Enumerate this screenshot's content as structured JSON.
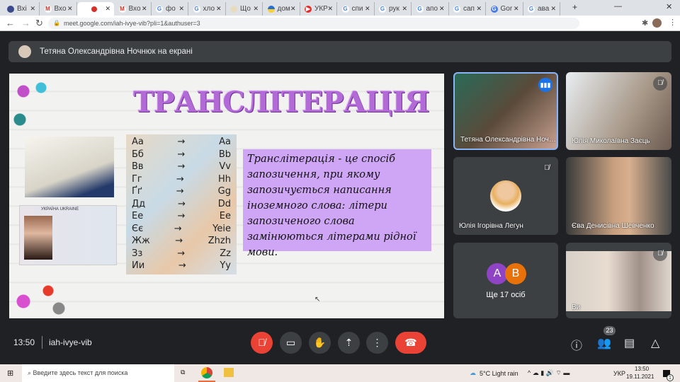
{
  "browser": {
    "tabs": [
      {
        "label": "Вхі",
        "icon": "app"
      },
      {
        "label": "Вхо",
        "icon": "gmail"
      },
      {
        "label": "",
        "icon": "meet",
        "active": true
      },
      {
        "label": "Вхо",
        "icon": "gmail"
      },
      {
        "label": "фо",
        "icon": "google"
      },
      {
        "label": "хло",
        "icon": "google"
      },
      {
        "label": "Що",
        "icon": "book"
      },
      {
        "label": "дом",
        "icon": "flag"
      },
      {
        "label": "УКР",
        "icon": "youtube"
      },
      {
        "label": "спи",
        "icon": "google"
      },
      {
        "label": "рук",
        "icon": "google"
      },
      {
        "label": "апо",
        "icon": "google"
      },
      {
        "label": "сап",
        "icon": "google"
      },
      {
        "label": "Gor",
        "icon": "translate"
      },
      {
        "label": "ава",
        "icon": "google"
      }
    ],
    "url": "meet.google.com/iah-ivye-vib?pli=1&authuser=3"
  },
  "presenter": {
    "label": "Тетяна Олександрівна Ночнюк на екрані"
  },
  "slide": {
    "title": "ТРАНСЛІТЕРАЦІЯ",
    "translit_table": [
      [
        "Аа",
        "Aa"
      ],
      [
        "Бб",
        "Bb"
      ],
      [
        "Вв",
        "Vv"
      ],
      [
        "Гг",
        "Hh"
      ],
      [
        "Ґґ",
        "Gg"
      ],
      [
        "Дд",
        "Dd"
      ],
      [
        "Ее",
        "Ee"
      ],
      [
        "Єє",
        "Yeie"
      ],
      [
        "Жж",
        "Zhzh"
      ],
      [
        "Зз",
        "Zz"
      ],
      [
        "Ии",
        "Yy"
      ]
    ],
    "arrow": "→",
    "definition": "Транслітерація - це спосіб запозичення, при якому запозичується написання іноземного слова: літери запозиченого слова замінюються літерами рідної мови.",
    "passport_label": "УКРАЇНА UKRAINE"
  },
  "participants": [
    {
      "name": "Тетяна Олександрівна Ночнюк",
      "speaking": true
    },
    {
      "name": "Юлія Миколаївна Заєць",
      "muted": true
    },
    {
      "name": "Юлія Ігорівна Легун",
      "muted": true
    },
    {
      "name": "Єва Денисівна Шевченко"
    },
    {
      "more_label": "Ще 17 осіб",
      "avatars": [
        "А",
        "В"
      ],
      "avatar_colors": [
        "#8e44c4",
        "#e8710a"
      ]
    },
    {
      "name": "Ви",
      "muted": true
    }
  ],
  "bottom": {
    "time": "13:50",
    "meeting_code": "iah-ivye-vib",
    "participants_count": "23"
  },
  "taskbar": {
    "search_placeholder": "Введите здесь текст для поиска",
    "weather": "5°C  Light rain",
    "lang": "УКР",
    "time": "13:50",
    "date": "19.11.2021",
    "notifications": "1"
  },
  "colors": {
    "accent": "#8ab4f8",
    "end_call": "#ea4335",
    "speaking": "#1a73e8"
  }
}
